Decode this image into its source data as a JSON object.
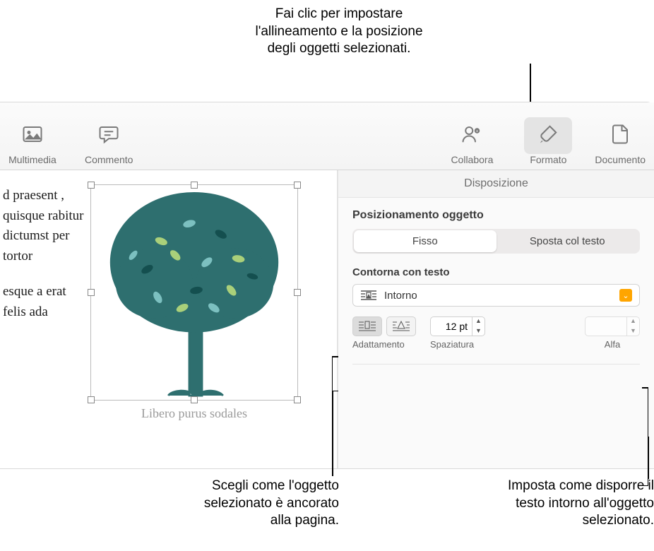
{
  "callouts": {
    "top": "Fai clic per impostare\nl'allineamento e la posizione\ndegli oggetti selezionati.",
    "bottom_left": "Scegli come l'oggetto\nselezionato è ancorato\nalla pagina.",
    "bottom_right": "Imposta come disporre il\ntesto intorno all'oggetto\nselezionato."
  },
  "toolbar": {
    "multimedia": "Multimedia",
    "commento": "Commento",
    "collabora": "Collabora",
    "formato": "Formato",
    "documento": "Documento"
  },
  "document": {
    "para1": "d praesent , quisque rabitur dictumst per tortor",
    "para2": "esque a erat felis ada",
    "caption": "Libero purus sodales"
  },
  "inspector": {
    "tab": "Disposizione",
    "section_position": "Posizionamento oggetto",
    "seg_fixed": "Fisso",
    "seg_move": "Sposta col testo",
    "section_wrap": "Contorna con testo",
    "wrap_value": "Intorno",
    "fit_label": "Adattamento",
    "spacing_label": "Spaziatura",
    "spacing_value": "12 pt",
    "alpha_label": "Alfa",
    "alpha_value": ""
  }
}
